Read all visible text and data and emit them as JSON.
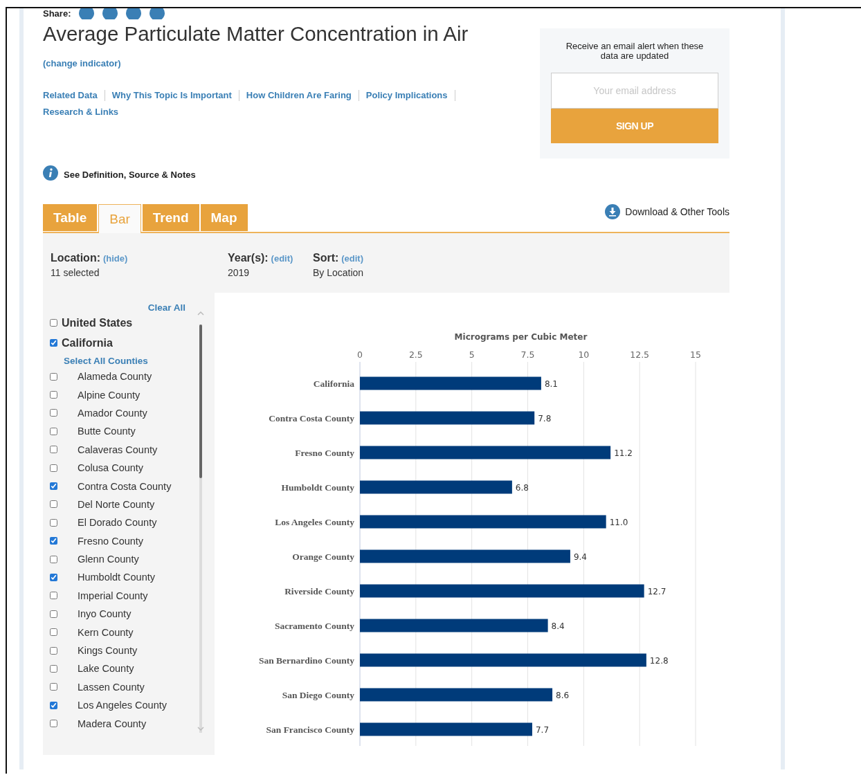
{
  "share": {
    "label": "Share:"
  },
  "title": "Average Particulate Matter Concentration in Air",
  "change_link": "(change indicator)",
  "nav_links": [
    "Related Data",
    "Why This Topic Is Important",
    "How Children Are Faring",
    "Policy Implications",
    "Research & Links"
  ],
  "alert": {
    "text": "Receive an email alert when these data are updated",
    "email_placeholder": "Your email address",
    "button": "SIGN UP"
  },
  "definition_link": "See Definition, Source & Notes",
  "tabs": [
    {
      "label": "Table",
      "selected": false
    },
    {
      "label": "Bar",
      "selected": true
    },
    {
      "label": "Trend",
      "selected": false
    },
    {
      "label": "Map",
      "selected": false
    }
  ],
  "tools_link": "Download & Other Tools",
  "filters": [
    {
      "label": "Location:",
      "action": "(hide)",
      "value": "11 selected"
    },
    {
      "label": "Year(s):",
      "action": "(edit)",
      "value": "2019"
    },
    {
      "label": "Sort:",
      "action": "(edit)",
      "value": "By Location"
    }
  ],
  "locations": {
    "clear_all": "Clear All",
    "states": [
      {
        "label": "United States",
        "checked": false
      },
      {
        "label": "California",
        "checked": true
      }
    ],
    "select_all": "Select All Counties",
    "counties": [
      {
        "label": "Alameda County",
        "checked": false
      },
      {
        "label": "Alpine County",
        "checked": false
      },
      {
        "label": "Amador County",
        "checked": false
      },
      {
        "label": "Butte County",
        "checked": false
      },
      {
        "label": "Calaveras County",
        "checked": false
      },
      {
        "label": "Colusa County",
        "checked": false
      },
      {
        "label": "Contra Costa County",
        "checked": true
      },
      {
        "label": "Del Norte County",
        "checked": false
      },
      {
        "label": "El Dorado County",
        "checked": false
      },
      {
        "label": "Fresno County",
        "checked": true
      },
      {
        "label": "Glenn County",
        "checked": false
      },
      {
        "label": "Humboldt County",
        "checked": true
      },
      {
        "label": "Imperial County",
        "checked": false
      },
      {
        "label": "Inyo County",
        "checked": false
      },
      {
        "label": "Kern County",
        "checked": false
      },
      {
        "label": "Kings County",
        "checked": false
      },
      {
        "label": "Lake County",
        "checked": false
      },
      {
        "label": "Lassen County",
        "checked": false
      },
      {
        "label": "Los Angeles County",
        "checked": true
      },
      {
        "label": "Madera County",
        "checked": false
      }
    ]
  },
  "chart_data": {
    "type": "bar",
    "orientation": "horizontal",
    "xlabel": "Micrograms per Cubic Meter",
    "categories": [
      "California",
      "Contra Costa County",
      "Fresno County",
      "Humboldt County",
      "Los Angeles County",
      "Orange County",
      "Riverside County",
      "Sacramento County",
      "San Bernardino County",
      "San Diego County",
      "San Francisco County"
    ],
    "series": [
      {
        "color": "#003b7a",
        "values": [
          8.1,
          7.8,
          11.2,
          6.8,
          11.0,
          9.4,
          12.7,
          8.4,
          12.8,
          8.6,
          7.7
        ]
      }
    ],
    "xlim": [
      0,
      15
    ],
    "xticks": [
      0,
      2.5,
      5,
      7.5,
      10,
      12.5,
      15
    ],
    "grid": true,
    "value_labels": [
      "8.1",
      "7.8",
      "11.2",
      "6.8",
      "11.0",
      "9.4",
      "12.7",
      "8.4",
      "12.8",
      "8.6",
      "7.7"
    ]
  }
}
